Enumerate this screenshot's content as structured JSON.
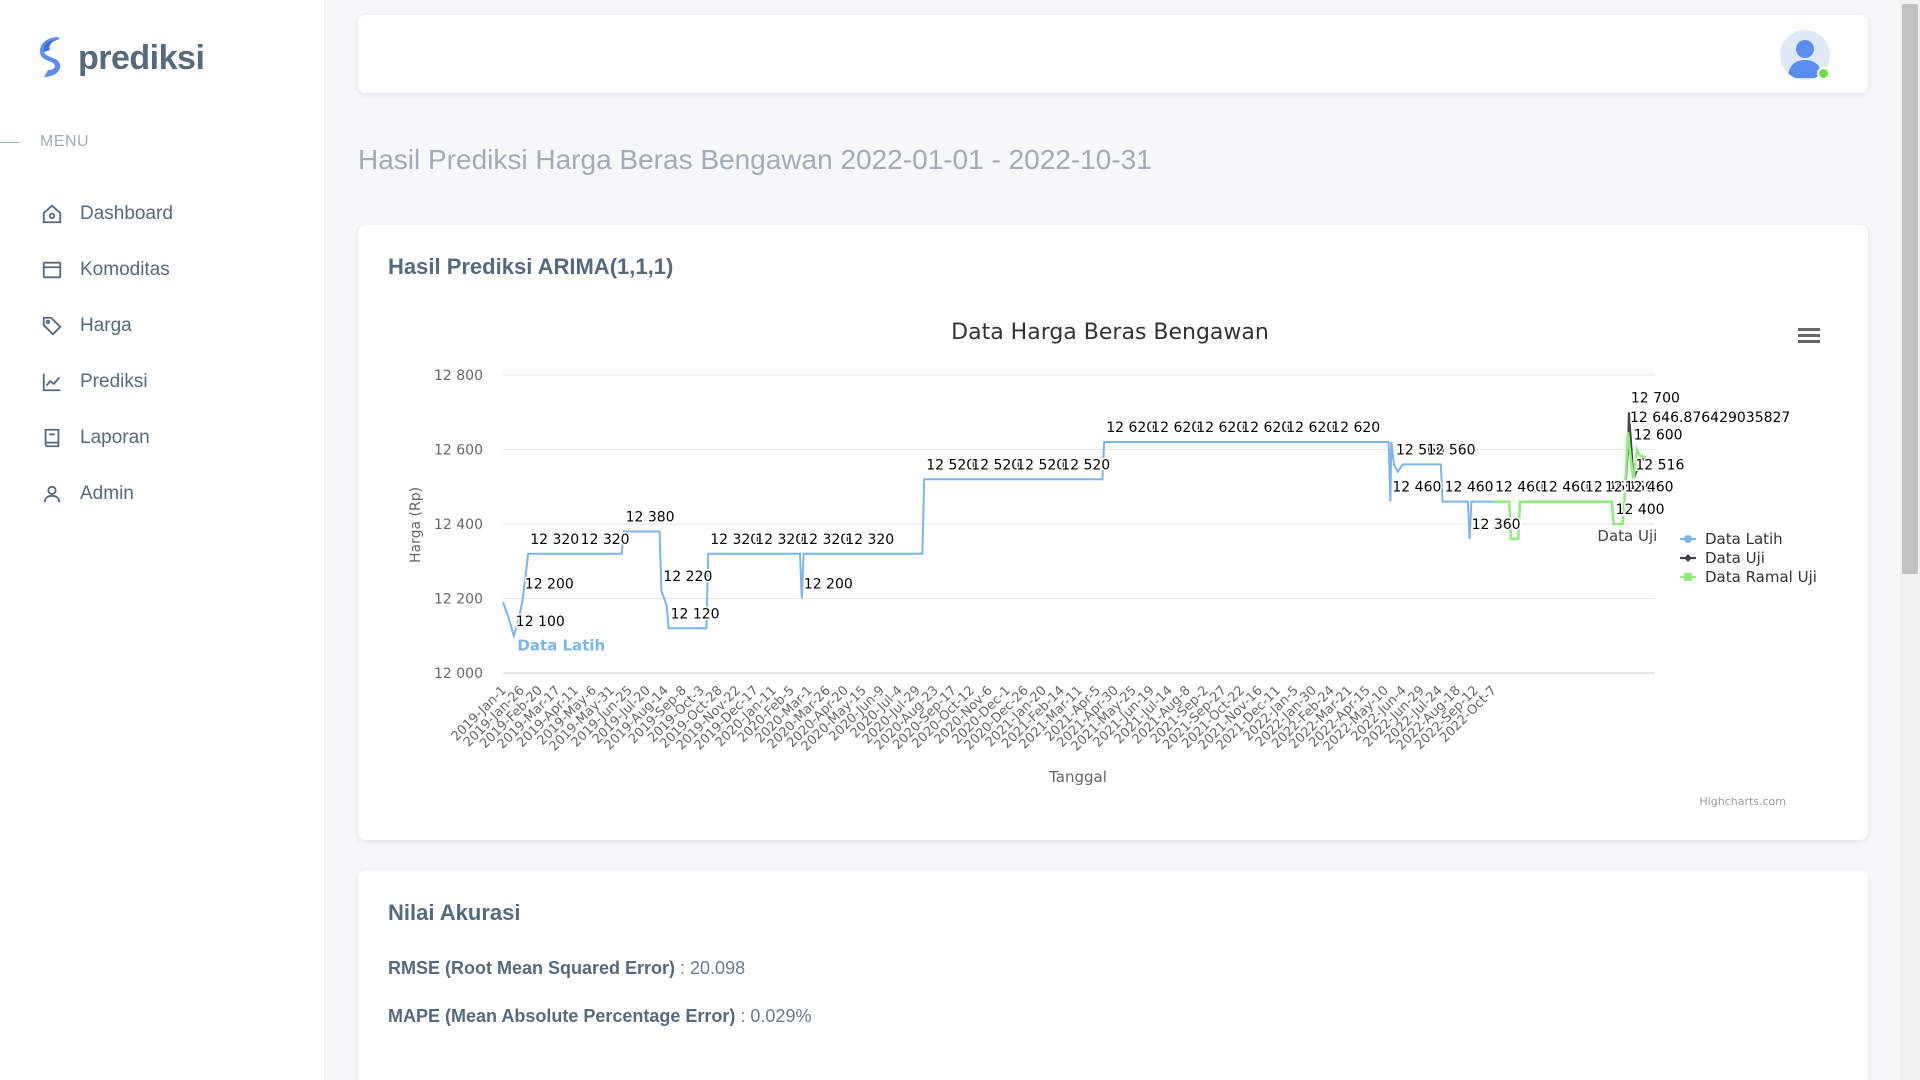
{
  "brand": {
    "name": "prediksi"
  },
  "sidebar": {
    "menu_header": "MENU",
    "items": [
      {
        "label": "Dashboard",
        "icon": "home-icon"
      },
      {
        "label": "Komoditas",
        "icon": "box-icon"
      },
      {
        "label": "Harga",
        "icon": "tag-icon"
      },
      {
        "label": "Prediksi",
        "icon": "chart-line-icon"
      },
      {
        "label": "Laporan",
        "icon": "book-icon"
      },
      {
        "label": "Admin",
        "icon": "user-icon"
      }
    ]
  },
  "page": {
    "title": "Hasil Prediksi Harga Beras Bengawan 2022-01-01 - 2022-10-31"
  },
  "chart_card": {
    "title": "Hasil Prediksi ARIMA(1,1,1)"
  },
  "chart_data": {
    "type": "line",
    "title": "Data Harga Beras Bengawan",
    "xlabel": "Tanggal",
    "ylabel": "Harga (Rp)",
    "ylim": [
      12000,
      12800
    ],
    "yticks": [
      "12 000",
      "12 200",
      "12 400",
      "12 600",
      "12 800"
    ],
    "credits": "Highcharts.com",
    "legend_position": "right",
    "x_tick_labels": [
      "2019-Jan-1",
      "2019-Jan-26",
      "2019-Feb-20",
      "2019-Mar-17",
      "2019-Apr-11",
      "2019-May-6",
      "2019-May-31",
      "2019-Jun-25",
      "2019-Jul-20",
      "2019-Aug-14",
      "2019-Sep-8",
      "2019-Oct-3",
      "2019-Oct-28",
      "2019-Nov-22",
      "2019-Dec-17",
      "2020-Jan-11",
      "2020-Feb-5",
      "2020-Mar-1",
      "2020-Mar-26",
      "2020-Apr-20",
      "2020-May-15",
      "2020-Jun-9",
      "2020-Jul-4",
      "2020-Jul-29",
      "2020-Aug-23",
      "2020-Sep-17",
      "2020-Oct-12",
      "2020-Nov-6",
      "2020-Dec-1",
      "2020-Dec-26",
      "2021-Jan-20",
      "2021-Feb-14",
      "2021-Mar-11",
      "2021-Apr-5",
      "2021-Apr-30",
      "2021-May-25",
      "2021-Jun-19",
      "2021-Jul-14",
      "2021-Aug-8",
      "2021-Sep-2",
      "2021-Sep-27",
      "2021-Oct-22",
      "2021-Nov-16",
      "2021-Dec-11",
      "2022-Jan-5",
      "2022-Jan-30",
      "2022-Feb-24",
      "2022-Mar-21",
      "2022-Apr-15",
      "2022-May-10",
      "2022-Jun-4",
      "2022-Jun-29",
      "2022-Jul-24",
      "2022-Aug-18",
      "2022-Sep-12",
      "2022-Oct-7"
    ],
    "series": [
      {
        "name": "Data Latih",
        "color": "#7cb5ec",
        "marker": "circle",
        "series_label": "Data Latih",
        "points": [
          [
            0.0,
            12190
          ],
          [
            0.3,
            12150
          ],
          [
            0.6,
            12100
          ],
          [
            0.9,
            12150
          ],
          [
            1.1,
            12200
          ],
          [
            1.4,
            12320
          ],
          [
            6.6,
            12320
          ],
          [
            6.7,
            12380
          ],
          [
            8.7,
            12380
          ],
          [
            8.8,
            12220
          ],
          [
            9.1,
            12180
          ],
          [
            9.2,
            12120
          ],
          [
            11.3,
            12120
          ],
          [
            11.4,
            12320
          ],
          [
            16.5,
            12320
          ],
          [
            16.6,
            12200
          ],
          [
            16.7,
            12320
          ],
          [
            23.3,
            12320
          ],
          [
            23.4,
            12520
          ],
          [
            33.3,
            12520
          ],
          [
            33.4,
            12620
          ],
          [
            49.2,
            12620
          ],
          [
            49.3,
            12460
          ],
          [
            49.35,
            12620
          ],
          [
            49.5,
            12560
          ],
          [
            49.7,
            12540
          ],
          [
            50.0,
            12560
          ],
          [
            52.1,
            12560
          ],
          [
            52.2,
            12460
          ],
          [
            53.6,
            12460
          ],
          [
            53.7,
            12360
          ],
          [
            53.8,
            12460
          ],
          [
            55.0,
            12460
          ]
        ],
        "data_labels": [
          {
            "x": 0.6,
            "y": 12100,
            "text": "12 100"
          },
          {
            "x": 1.1,
            "y": 12200,
            "text": "12 200"
          },
          {
            "x": 1.4,
            "y": 12320,
            "text": "12 320"
          },
          {
            "x": 4.2,
            "y": 12320,
            "text": "12 320"
          },
          {
            "x": 6.7,
            "y": 12380,
            "text": "12 380"
          },
          {
            "x": 8.8,
            "y": 12220,
            "text": "12 220"
          },
          {
            "x": 9.2,
            "y": 12120,
            "text": "12 120"
          },
          {
            "x": 11.4,
            "y": 12320,
            "text": "12 320"
          },
          {
            "x": 13.9,
            "y": 12320,
            "text": "12 320"
          },
          {
            "x": 16.4,
            "y": 12320,
            "text": "12 320"
          },
          {
            "x": 16.6,
            "y": 12200,
            "text": "12 200"
          },
          {
            "x": 18.9,
            "y": 12320,
            "text": "12 320"
          },
          {
            "x": 23.4,
            "y": 12520,
            "text": "12 520"
          },
          {
            "x": 25.9,
            "y": 12520,
            "text": "12 520"
          },
          {
            "x": 28.4,
            "y": 12520,
            "text": "12 520"
          },
          {
            "x": 30.9,
            "y": 12520,
            "text": "12 520"
          },
          {
            "x": 33.4,
            "y": 12620,
            "text": "12 620"
          },
          {
            "x": 35.9,
            "y": 12620,
            "text": "12 620"
          },
          {
            "x": 38.4,
            "y": 12620,
            "text": "12 620"
          },
          {
            "x": 40.9,
            "y": 12620,
            "text": "12 620"
          },
          {
            "x": 43.4,
            "y": 12620,
            "text": "12 620"
          },
          {
            "x": 45.9,
            "y": 12620,
            "text": "12 620"
          },
          {
            "x": 49.3,
            "y": 12460,
            "text": "12 460"
          },
          {
            "x": 49.5,
            "y": 12560,
            "text": "12 560"
          },
          {
            "x": 51.2,
            "y": 12560,
            "text": "12 560"
          },
          {
            "x": 52.2,
            "y": 12460,
            "text": "12 460"
          },
          {
            "x": 53.7,
            "y": 12360,
            "text": "12 360"
          }
        ]
      },
      {
        "name": "Data Uji",
        "color": "#434348",
        "marker": "diamond",
        "series_label": "Data Uji",
        "points": [
          [
            55.0,
            12460
          ],
          [
            55.9,
            12460
          ],
          [
            56.0,
            12360
          ],
          [
            56.4,
            12360
          ],
          [
            56.5,
            12460
          ],
          [
            61.6,
            12460
          ],
          [
            61.7,
            12400
          ],
          [
            62.2,
            12400
          ],
          [
            62.3,
            12460
          ],
          [
            62.5,
            12600
          ],
          [
            62.55,
            12700
          ],
          [
            62.7,
            12600
          ],
          [
            62.8,
            12520
          ],
          [
            63.3,
            12580
          ],
          [
            63.4,
            12570
          ]
        ],
        "data_labels": [
          {
            "x": 55.0,
            "y": 12460,
            "text": "12 460"
          },
          {
            "x": 57.5,
            "y": 12460,
            "text": "12 460"
          },
          {
            "x": 60.0,
            "y": 12460,
            "text": "12 460"
          },
          {
            "x": 61.1,
            "y": 12460,
            "text": "12 460"
          },
          {
            "x": 62.2,
            "y": 12460,
            "text": "12 460"
          },
          {
            "x": 61.7,
            "y": 12400,
            "text": "12 400"
          },
          {
            "x": 62.55,
            "y": 12700,
            "text": "12 700"
          },
          {
            "x": 62.7,
            "y": 12600,
            "text": "12 600"
          },
          {
            "x": 62.8,
            "y": 12520,
            "text": "12 516"
          }
        ]
      },
      {
        "name": "Data Ramal Uji",
        "color": "#90ed7d",
        "marker": "square",
        "series_label": "Data Ramal Uji",
        "points": [
          [
            55.0,
            12460
          ],
          [
            55.9,
            12460
          ],
          [
            56.0,
            12360
          ],
          [
            56.4,
            12360
          ],
          [
            56.5,
            12460
          ],
          [
            61.6,
            12460
          ],
          [
            61.7,
            12400
          ],
          [
            62.2,
            12400
          ],
          [
            62.3,
            12460
          ],
          [
            62.5,
            12647
          ],
          [
            62.6,
            12600
          ],
          [
            62.8,
            12516
          ],
          [
            63.0,
            12600
          ],
          [
            63.2,
            12580
          ],
          [
            63.5,
            12580
          ]
        ],
        "data_labels": [
          {
            "x": 62.5,
            "y": 12647,
            "text": "12 646.876429035827"
          }
        ]
      }
    ]
  },
  "accuracy": {
    "title": "Nilai Akurasi",
    "rmse_label": "RMSE (Root Mean Squared Error)",
    "rmse_value": " : 20.098",
    "mape_label": "MAPE (Mean Absolute Percentage Error)",
    "mape_value": " : 0.029%"
  },
  "colors": {
    "sidebar_bg": "#ffffff",
    "page_bg": "#f6f7f9",
    "status_online": "#71dd37"
  }
}
